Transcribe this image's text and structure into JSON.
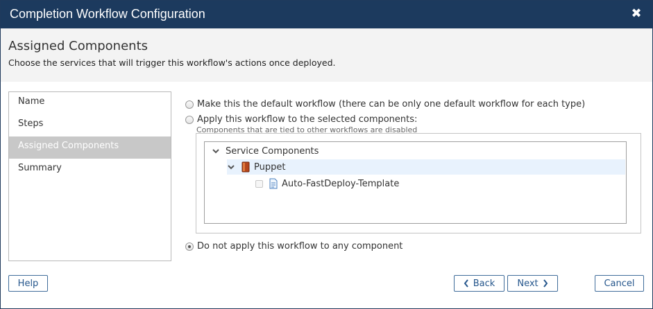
{
  "titlebar": {
    "title": "Completion Workflow Configuration",
    "close_icon": "close-icon"
  },
  "header": {
    "title": "Assigned Components",
    "description": "Choose the services that will trigger this workflow's actions once deployed."
  },
  "nav": {
    "items": [
      {
        "label": "Name"
      },
      {
        "label": "Steps"
      },
      {
        "label": "Assigned Components",
        "active": true
      },
      {
        "label": "Summary"
      }
    ]
  },
  "options": {
    "default_label": "Make this the default workflow (there can be only one default workflow for each type)",
    "apply_label": "Apply this workflow to the selected components:",
    "apply_note": "Components that are tied to other workflows are disabled",
    "none_label": "Do not apply this workflow to any component",
    "selected": "none"
  },
  "tree": {
    "root_label": "Service Components",
    "group_label": "Puppet",
    "item_label": "Auto-FastDeploy-Template",
    "item_checked": false
  },
  "footer": {
    "help_label": "Help",
    "back_label": "Back",
    "next_label": "Next",
    "cancel_label": "Cancel"
  },
  "colors": {
    "titlebar": "#1c3a5e",
    "accent": "#25568c",
    "nav_active": "#c8c8c8",
    "tree_selected": "#e8f2fd"
  }
}
